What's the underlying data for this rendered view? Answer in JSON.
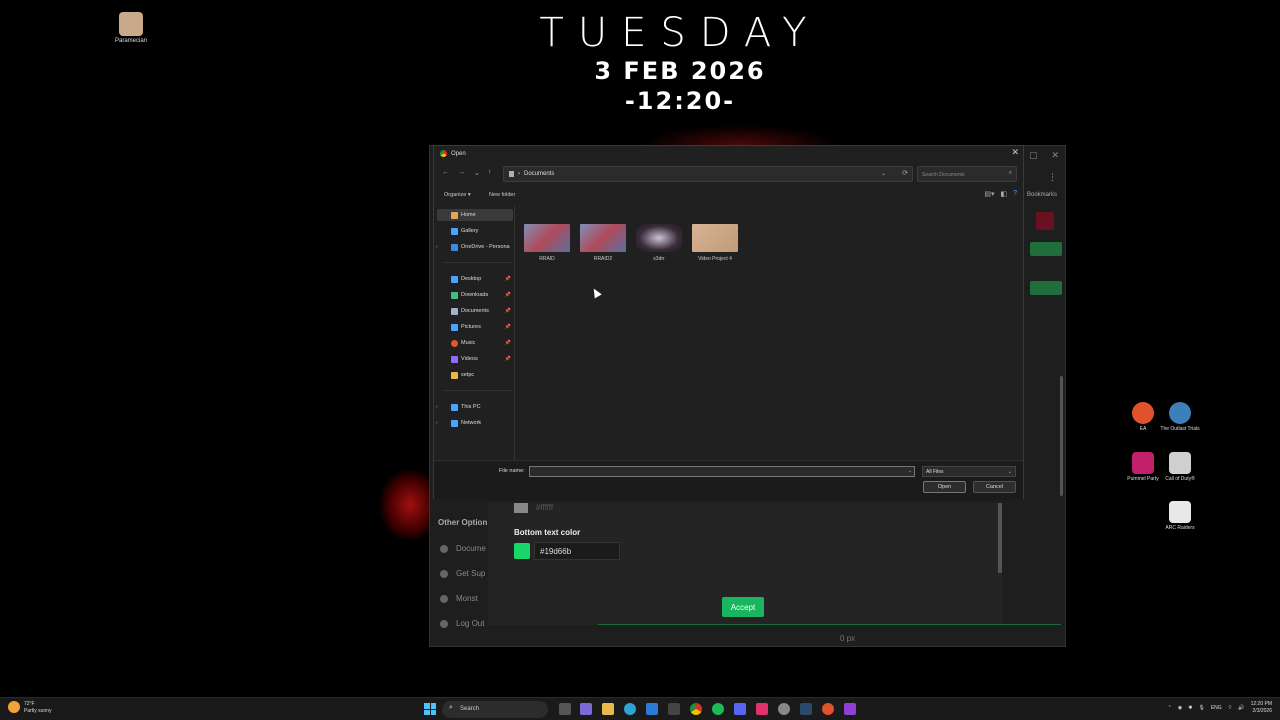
{
  "desktop": {
    "clock": {
      "day": "TUESDAY",
      "date": "3 FEB 2026",
      "time": "-12:20-"
    },
    "top_left_icon": {
      "label": "Paramecian"
    },
    "right_icons": [
      {
        "label": "EA",
        "color": "#e0522b"
      },
      {
        "label": "The Outlast Trials",
        "color": "#3d7fb8"
      },
      {
        "label": "Pummel Party",
        "color": "#c2206b"
      },
      {
        "label": "Call of Duty®",
        "color": "#cfcfcf"
      },
      {
        "label": "ARC Raiders",
        "color": "#e8e8e8"
      }
    ]
  },
  "background_window": {
    "bookmarks_label": "Bookmarks",
    "other_options_heading": "Other Option",
    "menu_items": [
      "Docume",
      "Get Sup",
      "Monst",
      "Log Out"
    ],
    "gray_hex": "#ffffff",
    "bottom_text_label": "Bottom text color",
    "bottom_text_hex": "#19d66b",
    "swatch_color": "#19d66b",
    "accept_label": "Accept",
    "px_label": "0 px"
  },
  "dialog": {
    "title": "Open",
    "close_label": "✕",
    "address": {
      "path": "Documents"
    },
    "search_placeholder": "Search Documents",
    "toolbar": {
      "organize": "Organize ▾",
      "new_folder": "New folder"
    },
    "nav": [
      {
        "label": "Home",
        "icon": "home-icon",
        "color": "#e8a35b"
      },
      {
        "label": "Gallery",
        "icon": "gallery-icon",
        "color": "#4aa3ff"
      },
      {
        "label": "OneDrive - Persona",
        "icon": "cloud-icon",
        "color": "#3c8de0"
      },
      {
        "label": "Desktop",
        "icon": "desktop-icon",
        "color": "#4aa3ff"
      },
      {
        "label": "Downloads",
        "icon": "download-icon",
        "color": "#3fbf7f"
      },
      {
        "label": "Documents",
        "icon": "document-icon",
        "color": "#9fb3c8"
      },
      {
        "label": "Pictures",
        "icon": "pictures-icon",
        "color": "#4aa3ff"
      },
      {
        "label": "Music",
        "icon": "music-icon",
        "color": "#e2572e"
      },
      {
        "label": "Videos",
        "icon": "video-icon",
        "color": "#8f6bff"
      },
      {
        "label": "setpc",
        "icon": "folder-icon",
        "color": "#e8b84a"
      },
      {
        "label": "This PC",
        "icon": "pc-icon",
        "color": "#4aa3ff"
      },
      {
        "label": "Network",
        "icon": "network-icon",
        "color": "#4aa3ff"
      }
    ],
    "files": [
      {
        "name": "RRAID"
      },
      {
        "name": "RRAID2"
      },
      {
        "name": "s3drr"
      },
      {
        "name": "Video Project 4"
      }
    ],
    "filename_label": "File name:",
    "filename_value": "",
    "filetype_value": "All Files",
    "open_label": "Open",
    "cancel_label": "Cancel"
  },
  "taskbar": {
    "weather_temp": "72°F",
    "weather_desc": "Partly sunny",
    "search_label": "Search",
    "lang": "ENG",
    "time": "12:20 PM",
    "date": "2/3/2026"
  }
}
